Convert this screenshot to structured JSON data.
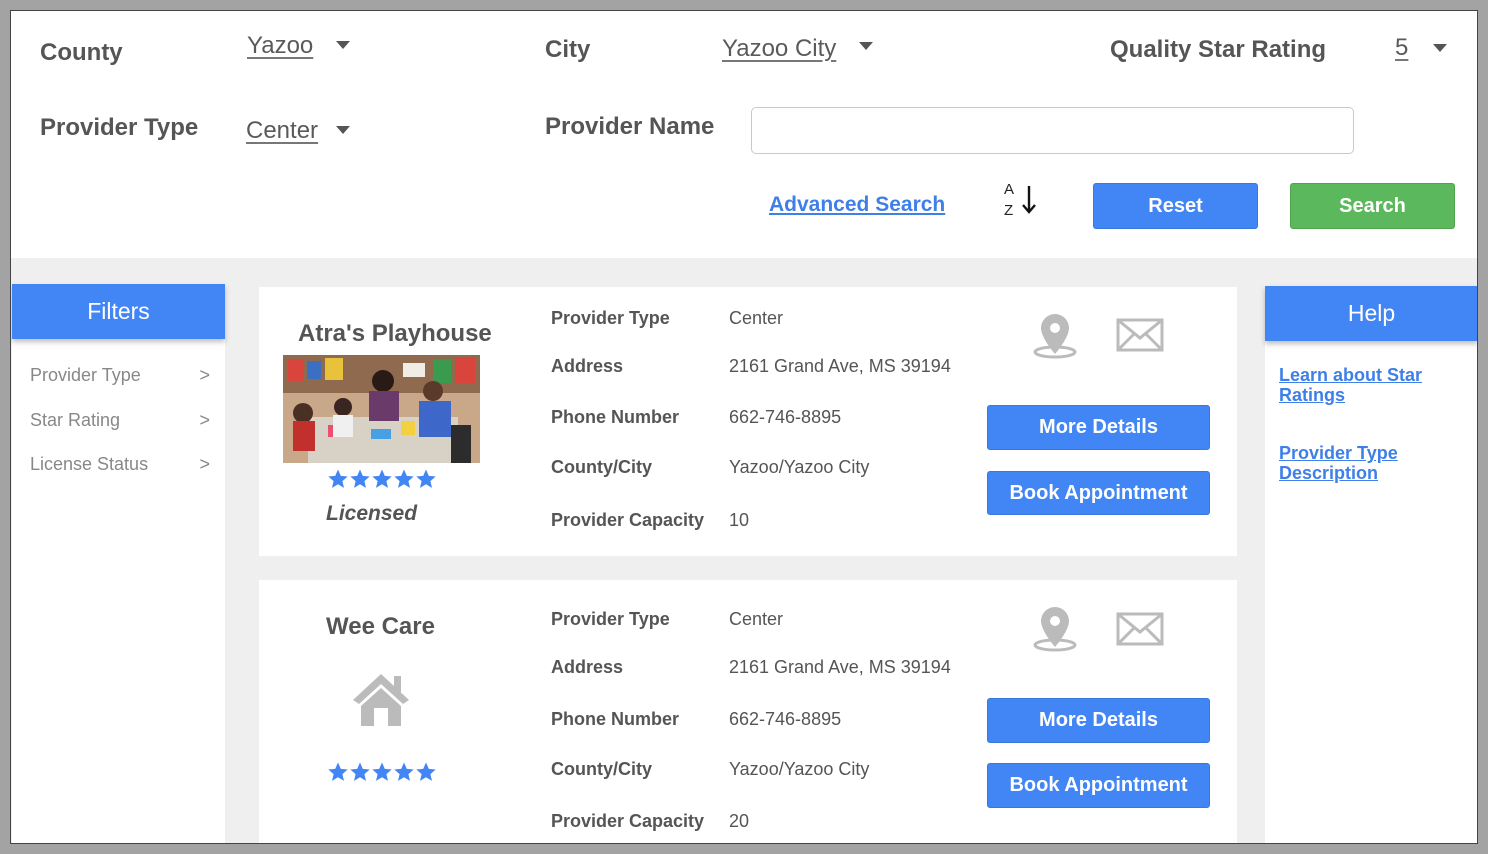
{
  "search": {
    "county_label": "County",
    "county_value": "Yazoo",
    "city_label": "City",
    "city_value": "Yazoo City",
    "rating_label": "Quality Star Rating",
    "rating_value": "5",
    "provider_type_label": "Provider Type",
    "provider_type_value": "Center",
    "provider_name_label": "Provider Name",
    "provider_name_value": "",
    "advanced_search": "Advanced Search",
    "sort_top": "A",
    "sort_bottom": "Z",
    "reset_label": "Reset",
    "search_label": "Search"
  },
  "filters": {
    "title": "Filters",
    "items": [
      {
        "label": "Provider Type",
        "chevron": ">"
      },
      {
        "label": "Star Rating",
        "chevron": ">"
      },
      {
        "label": "License Status",
        "chevron": ">"
      }
    ]
  },
  "help": {
    "title": "Help",
    "links": [
      "Learn about Star Ratings",
      "Provider Type Description"
    ]
  },
  "field_labels": {
    "provider_type": "Provider Type",
    "address": "Address",
    "phone": "Phone Number",
    "county_city": "County/City",
    "capacity": "Provider Capacity"
  },
  "providers": [
    {
      "name": "Atra's Playhouse",
      "stars": 5,
      "status": "Licensed",
      "provider_type": "Center",
      "address": "2161 Grand Ave, MS 39194",
      "phone": "662-746-8895",
      "county_city": "Yazoo/Yazoo City",
      "capacity": "10",
      "more_details": "More Details",
      "book": "Book Appointment"
    },
    {
      "name": "Wee Care",
      "stars": 5,
      "provider_type": "Center",
      "address": "2161 Grand Ave, MS 39194",
      "phone": "662-746-8895",
      "county_city": "Yazoo/Yazoo City",
      "capacity": "20",
      "more_details": "More Details",
      "book": "Book Appointment"
    }
  ],
  "colors": {
    "primary": "#4285f4",
    "success": "#5cb85c",
    "link": "#3e7fe8",
    "star": "#4285f4"
  }
}
